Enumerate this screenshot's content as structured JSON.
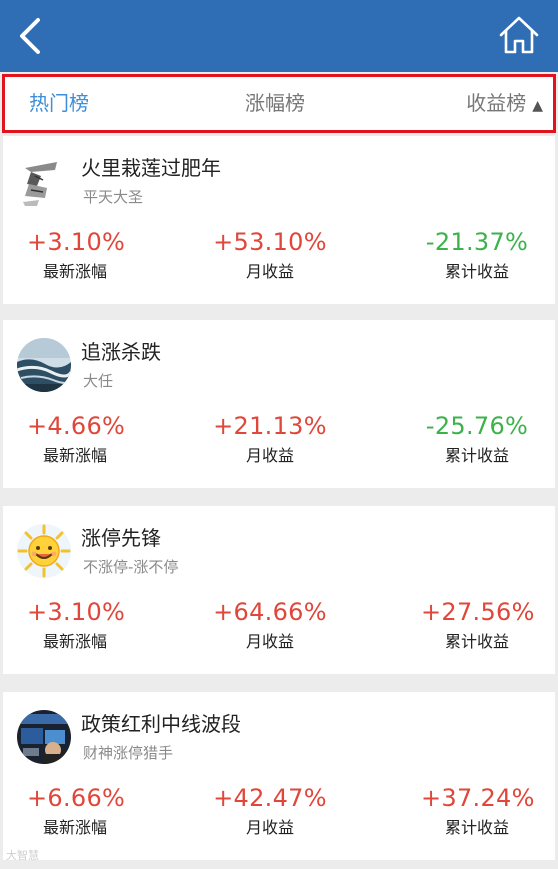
{
  "tabs": [
    {
      "label": "热门榜",
      "active": true
    },
    {
      "label": "涨幅榜",
      "active": false
    },
    {
      "label": "收益榜",
      "active": false,
      "sort_icon": "▲"
    }
  ],
  "cards": [
    {
      "name": "火里栽莲过肥年",
      "author": "平天大圣",
      "avatar_icon": "sketch-figure-avatar",
      "stats": [
        {
          "value": "+3.10%",
          "label": "最新涨幅",
          "trend": "up"
        },
        {
          "value": "+53.10%",
          "label": "月收益",
          "trend": "up"
        },
        {
          "value": "-21.37%",
          "label": "累计收益",
          "trend": "down"
        }
      ]
    },
    {
      "name": "追涨杀跌",
      "author": "大任",
      "avatar_icon": "ocean-wave-avatar",
      "stats": [
        {
          "value": "+4.66%",
          "label": "最新涨幅",
          "trend": "up"
        },
        {
          "value": "+21.13%",
          "label": "月收益",
          "trend": "up"
        },
        {
          "value": "-25.76%",
          "label": "累计收益",
          "trend": "down"
        }
      ]
    },
    {
      "name": "涨停先锋",
      "author": "不涨停-涨不停",
      "avatar_icon": "smiling-sun-avatar",
      "stats": [
        {
          "value": "+3.10%",
          "label": "最新涨幅",
          "trend": "up"
        },
        {
          "value": "+64.66%",
          "label": "月收益",
          "trend": "up"
        },
        {
          "value": "+27.56%",
          "label": "累计收益",
          "trend": "up"
        }
      ]
    },
    {
      "name": "政策红利中线波段",
      "author": "财神涨停猎手",
      "avatar_icon": "dark-photo-avatar",
      "stats": [
        {
          "value": "+6.66%",
          "label": "最新涨幅",
          "trend": "up"
        },
        {
          "value": "+42.47%",
          "label": "月收益",
          "trend": "up"
        },
        {
          "value": "+37.24%",
          "label": "累计收益",
          "trend": "up"
        }
      ]
    }
  ],
  "watermark": "大智慧",
  "colors": {
    "header": "#2f6db4",
    "active_tab": "#3e8ed8",
    "up": "#e0463a",
    "down": "#3cb24a",
    "tab_highlight_border": "#e3131b"
  }
}
